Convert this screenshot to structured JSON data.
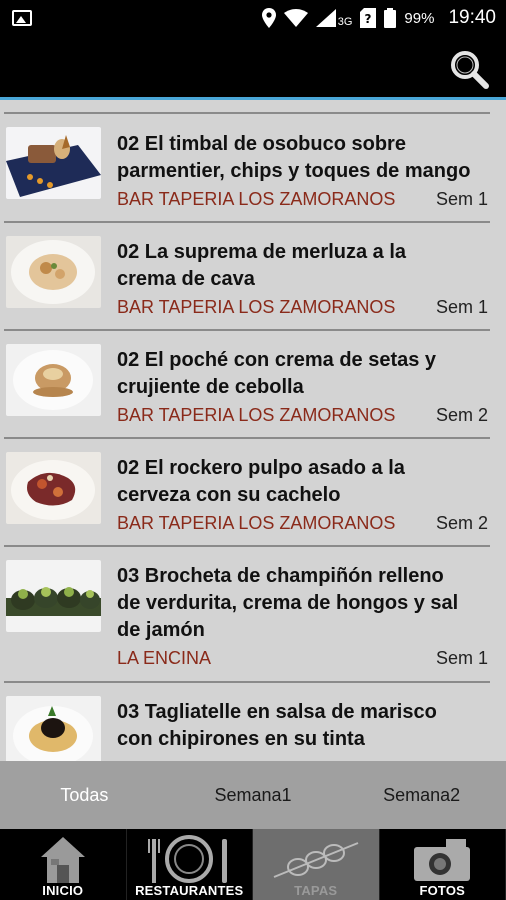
{
  "status_bar": {
    "network": "3G",
    "battery": "99%",
    "time": "19:40"
  },
  "list": {
    "items": [
      {
        "title_line1": "02 El timbal de osobuco sobre",
        "title_line2": "parmentier, chips y toques de mango",
        "title_line3": "",
        "restaurant": "BAR TAPERIA LOS ZAMORANOS",
        "week": "Sem 1"
      },
      {
        "title_line1": "02 La suprema de merluza a la",
        "title_line2": "crema de cava",
        "title_line3": "",
        "restaurant": "BAR TAPERIA LOS ZAMORANOS",
        "week": "Sem 1"
      },
      {
        "title_line1": "02 El poché con crema de setas y",
        "title_line2": "crujiente de cebolla",
        "title_line3": "",
        "restaurant": "BAR TAPERIA LOS ZAMORANOS",
        "week": "Sem 2"
      },
      {
        "title_line1": "02 El rockero pulpo asado a la",
        "title_line2": "cerveza con su cachelo",
        "title_line3": "",
        "restaurant": "BAR TAPERIA LOS ZAMORANOS",
        "week": "Sem 2"
      },
      {
        "title_line1": "03 Brocheta de champiñón relleno",
        "title_line2": "de verdurita, crema de hongos y sal",
        "title_line3": "de jamón",
        "restaurant": "LA ENCINA",
        "week": "Sem 1"
      },
      {
        "title_line1": "03 Tagliatelle en salsa de marisco",
        "title_line2": "con chipirones en su tinta",
        "title_line3": "",
        "restaurant": "",
        "week": ""
      }
    ]
  },
  "tabs": [
    {
      "label": "Todas",
      "active": true
    },
    {
      "label": "Semana1",
      "active": false
    },
    {
      "label": "Semana2",
      "active": false
    }
  ],
  "bottom_nav": [
    {
      "label": "INICIO",
      "icon": "house-icon",
      "active": false
    },
    {
      "label": "RESTAURANTES",
      "icon": "plate-cutlery-icon",
      "active": false
    },
    {
      "label": "TAPAS",
      "icon": "skewer-icon",
      "active": true
    },
    {
      "label": "FOTOS",
      "icon": "camera-icon",
      "active": false
    }
  ],
  "colors": {
    "accent": "#4aa7d8",
    "restaurant_text": "#8a2a1a",
    "list_background": "#d3d3d3",
    "tabs_background": "#a0a0a0"
  }
}
